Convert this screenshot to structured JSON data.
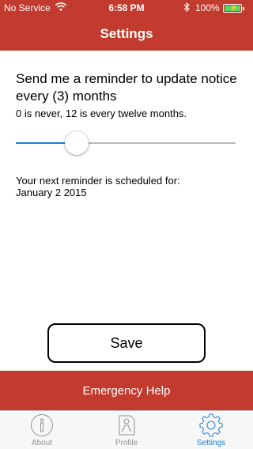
{
  "status_bar": {
    "carrier": "No Service",
    "time": "6:58 PM",
    "battery_percent": "100%",
    "battery_level": 1.0
  },
  "nav": {
    "title": "Settings"
  },
  "reminder": {
    "text": "Send me a reminder to update notice every (3) months",
    "hint": "0 is never, 12 is every twelve months.",
    "slider_value": 3,
    "slider_min": 0,
    "slider_max": 12
  },
  "schedule": {
    "label": "Your next reminder is scheduled for:",
    "date": "January 2 2015"
  },
  "actions": {
    "save_label": "Save",
    "emergency_label": "Emergency Help"
  },
  "tabs": [
    {
      "label": "About",
      "icon": "info-icon",
      "active": false
    },
    {
      "label": "Profile",
      "icon": "profile-icon",
      "active": false
    },
    {
      "label": "Settings",
      "icon": "gear-icon",
      "active": true
    }
  ],
  "colors": {
    "brand_red": "#c23b2e",
    "accent_blue": "#1a7fd8",
    "tab_inactive": "#929292"
  }
}
